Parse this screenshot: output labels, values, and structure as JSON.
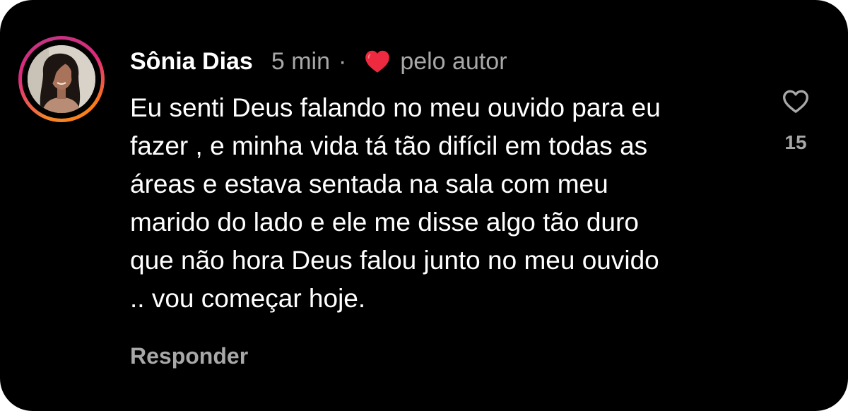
{
  "comment": {
    "author": "Sônia Dias",
    "time": "5 min",
    "separator": "·",
    "liked_by_author_icon": "red-heart-icon",
    "liked_by_author_label": "pelo autor",
    "text": "Eu senti Deus falando no meu ouvido para eu\nfazer , e minha vida tá tão difícil em todas as\náreas e estava sentada na sala com meu\nmarido do lado e ele me disse algo tão duro\nque não hora Deus falou junto no meu ouvido\n.. vou começar hoje.",
    "reply_label": "Responder",
    "like_icon": "heart-outline-icon",
    "like_count": "15"
  },
  "colors": {
    "background": "#000000",
    "primary_text": "#ffffff",
    "secondary_text": "#a8a8a8",
    "author_heart": "#ed2a3f",
    "story_ring": [
      "#f58529",
      "#dd2a7b",
      "#c13584"
    ]
  }
}
